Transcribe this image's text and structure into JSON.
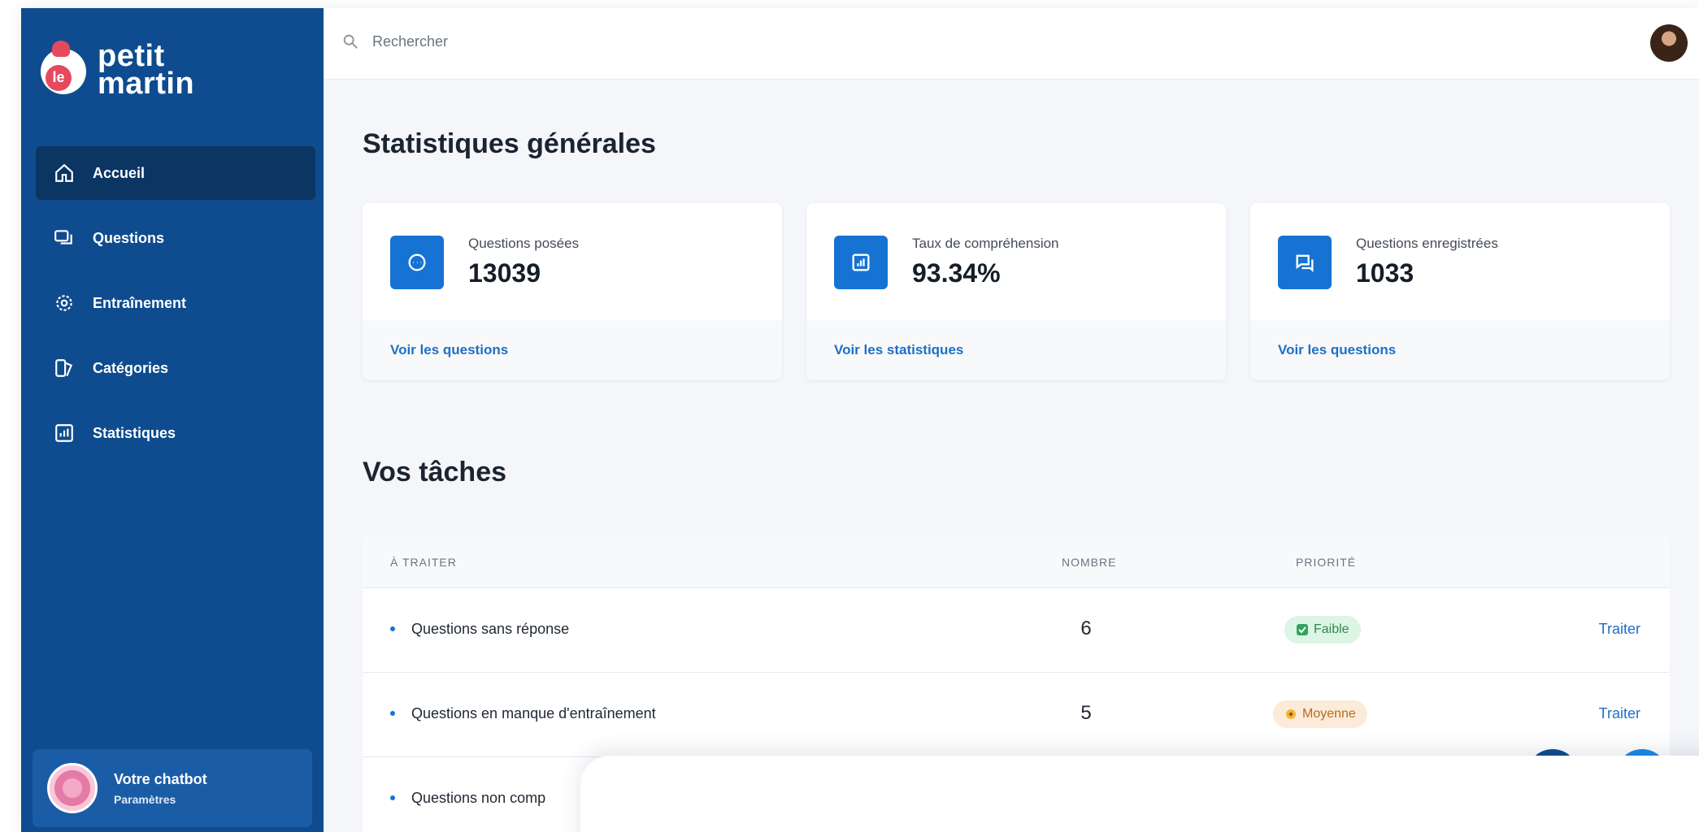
{
  "brand": {
    "mark_text": "le",
    "line1": "petit",
    "line2": "martin"
  },
  "sidebar": {
    "items": [
      {
        "label": "Accueil",
        "icon": "home-icon",
        "active": true
      },
      {
        "label": "Questions",
        "icon": "chat-icon",
        "active": false
      },
      {
        "label": "Entraînement",
        "icon": "gear-icon",
        "active": false
      },
      {
        "label": "Catégories",
        "icon": "tags-icon",
        "active": false
      },
      {
        "label": "Statistiques",
        "icon": "chart-icon",
        "active": false
      }
    ],
    "chatbot": {
      "title": "Votre chatbot",
      "subtitle": "Paramètres"
    }
  },
  "topbar": {
    "search_placeholder": "Rechercher"
  },
  "stats": {
    "title": "Statistiques générales",
    "cards": [
      {
        "label": "Questions posées",
        "value": "13039",
        "link": "Voir les questions",
        "icon": "message-icon"
      },
      {
        "label": "Taux de compréhension",
        "value": "93.34%",
        "link": "Voir les statistiques",
        "icon": "chart-icon"
      },
      {
        "label": "Questions enregistrées",
        "value": "1033",
        "link": "Voir les questions",
        "icon": "chat-icon"
      }
    ]
  },
  "tasks": {
    "title": "Vos tâches",
    "columns": {
      "task": "À TRAITER",
      "count": "NOMBRE",
      "priority": "PRIORITÉ"
    },
    "rows": [
      {
        "task": "Questions sans réponse",
        "count": "6",
        "priority": "Faible",
        "action": "Traiter"
      },
      {
        "task": "Questions en manque d'entraînement",
        "count": "5",
        "priority": "Moyenne",
        "action": "Traiter"
      },
      {
        "task": "Questions non comp",
        "count": "",
        "priority": "",
        "action": ""
      }
    ]
  },
  "colors": {
    "sidebar": "#0f4c8f",
    "sidebar_active": "#0b3563",
    "accent": "#1673d4",
    "link": "#1f6fc5",
    "badge_low": "#dcf5e4",
    "badge_mid": "#fcebd8"
  }
}
